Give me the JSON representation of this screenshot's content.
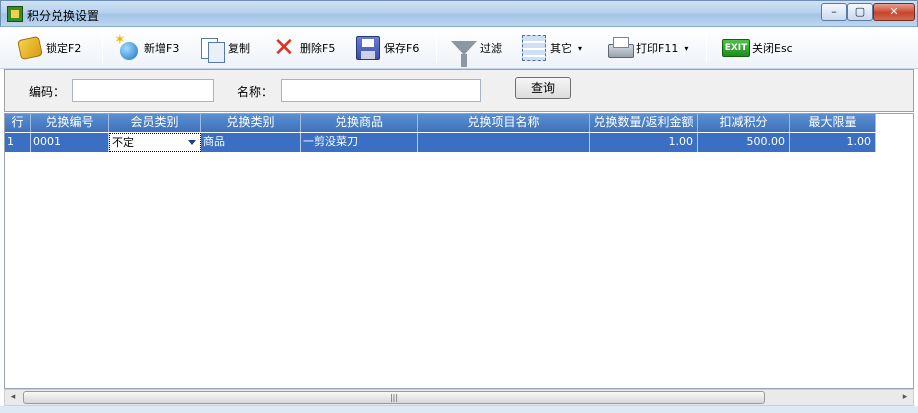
{
  "window": {
    "title": "积分兑换设置",
    "minimize_glyph": "–",
    "maximize_glyph": "▢",
    "close_glyph": "✕"
  },
  "toolbar": {
    "lock": {
      "label": "锁定F2",
      "icon": "lock-icon"
    },
    "add": {
      "label": "新增F3",
      "icon": "new-globe-icon"
    },
    "copy": {
      "label": "复制",
      "icon": "copy-icon"
    },
    "delete": {
      "label": "删除F5",
      "icon": "delete-x-icon"
    },
    "save": {
      "label": "保存F6",
      "icon": "floppy-disk-icon"
    },
    "filter": {
      "label": "过滤",
      "icon": "filter-funnel-icon"
    },
    "other": {
      "label": "其它",
      "icon": "list-icon",
      "dropdown_glyph": "▾"
    },
    "print": {
      "label": "打印F11",
      "icon": "printer-icon",
      "dropdown_glyph": "▾"
    },
    "close": {
      "label": "关闭Esc",
      "icon": "exit-icon",
      "icon_text": "EXIT"
    }
  },
  "search": {
    "code_label": "编码：",
    "code_value": "",
    "name_label": "名称：",
    "name_value": "",
    "query_button": "查询"
  },
  "grid": {
    "columns": [
      "行",
      "兑换编号",
      "会员类别",
      "兑换类别",
      "兑换商品",
      "兑换项目名称",
      "兑换数量/返利金额",
      "扣减积分",
      "最大限量"
    ],
    "rows": [
      {
        "row_no": "1",
        "code": "0001",
        "member_type": "不定",
        "exchange_type": "商品",
        "goods": "一剪没菜刀",
        "item_name": "",
        "quantity": "1.00",
        "points": "500.00",
        "max_limit": "1.00"
      }
    ]
  },
  "scrollbar": {
    "left_glyph": "◂",
    "right_glyph": "▸",
    "thumb_grip": "|||"
  },
  "colors": {
    "header_blue": "#3e71b9",
    "selected_row": "#3a6fc4",
    "title_bar": "#b7d2ec"
  }
}
